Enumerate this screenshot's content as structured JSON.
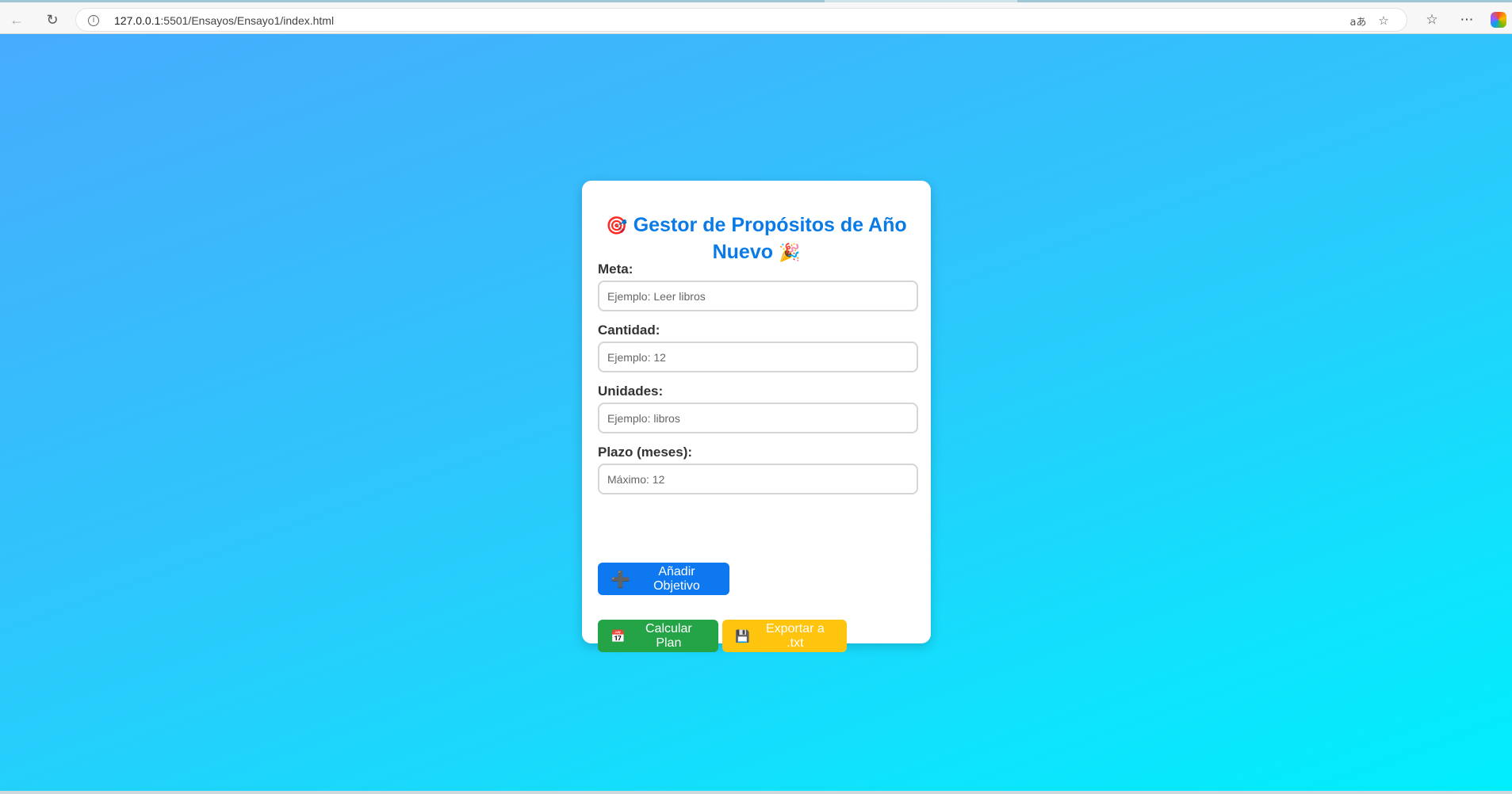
{
  "browser": {
    "url_host": "127.0.0.1",
    "url_path": ":5501/Ensayos/Ensayo1/index.html",
    "read_aloud_label": "aあ"
  },
  "app": {
    "title_line1": "Gestor de Propósitos de Año",
    "title_line2": "Nuevo",
    "title_icon_start": "🎯",
    "title_icon_end": "🎉"
  },
  "form": {
    "meta": {
      "label": "Meta:",
      "placeholder": "Ejemplo: Leer libros"
    },
    "cantidad": {
      "label": "Cantidad:",
      "placeholder": "Ejemplo: 12"
    },
    "unidades": {
      "label": "Unidades:",
      "placeholder": "Ejemplo: libros"
    },
    "plazo": {
      "label": "Plazo (meses):",
      "placeholder": "Máximo: 12"
    }
  },
  "buttons": {
    "add": {
      "icon": "➕",
      "label": "Añadir Objetivo"
    },
    "calc": {
      "icon": "📅",
      "label": "Calcular Plan"
    },
    "export": {
      "icon": "💾",
      "label": "Exportar a .txt"
    }
  },
  "colors": {
    "title": "#0a7ae6",
    "add_button": "#0d78f0",
    "calc_button": "#24a347",
    "export_button": "#ffc40d"
  }
}
